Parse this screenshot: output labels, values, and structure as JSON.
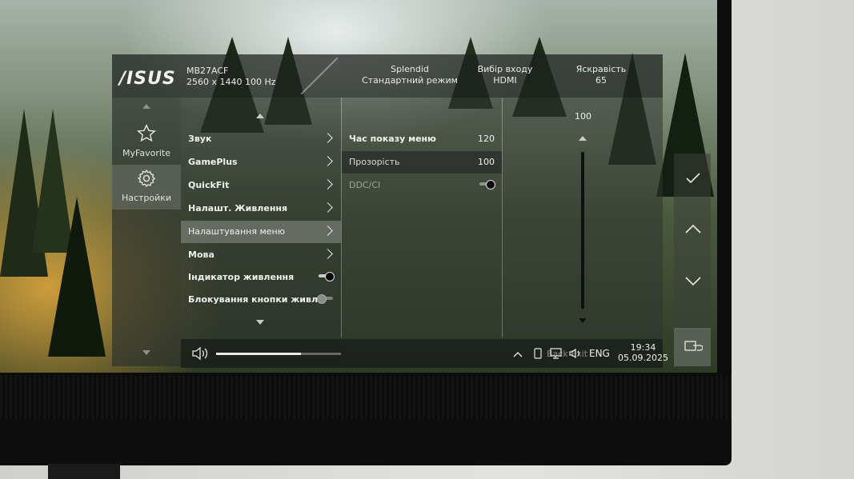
{
  "osd": {
    "brand": "/ISUS",
    "model": "MB27ACF",
    "spec": "2560 x 1440    100 Hz",
    "header_stats": [
      {
        "label": "Splendid",
        "value": "Стандартний режим"
      },
      {
        "label": "Вибір входу",
        "value": "HDMI"
      },
      {
        "label": "Яскравість",
        "value": "65"
      }
    ],
    "sidebar": [
      {
        "label": "MyFavorite",
        "icon": "star-icon",
        "selected": false
      },
      {
        "label": "Настройки",
        "icon": "gear-icon",
        "selected": true
      }
    ],
    "menu": [
      {
        "label": "Звук",
        "type": "submenu"
      },
      {
        "label": "GamePlus",
        "type": "submenu"
      },
      {
        "label": "QuickFit",
        "type": "submenu"
      },
      {
        "label": "Налашт. Живлення",
        "type": "submenu"
      },
      {
        "label": "Налаштування меню",
        "type": "submenu",
        "selected": true
      },
      {
        "label": "Мова",
        "type": "submenu"
      },
      {
        "label": "Індикатор живлення",
        "type": "toggle",
        "on": true
      },
      {
        "label": "Блокування кнопки живл.",
        "type": "toggle",
        "on": false
      }
    ],
    "submenu": [
      {
        "label": "Час показу меню",
        "value": "120"
      },
      {
        "label": "Прозорість",
        "value": "100",
        "selected": true
      },
      {
        "label": "DDC/CI",
        "toggle": true,
        "dim": true
      }
    ],
    "slider": {
      "value": "100"
    }
  },
  "taskbar": {
    "volume_fraction": 0.68,
    "overlay_text": "Back  Exit",
    "language": "ENG",
    "time": "19:34",
    "date": "05.09.2025"
  },
  "buttons": [
    "check-icon",
    "chevron-up-icon",
    "chevron-down-icon",
    "input-source-icon"
  ],
  "colors": {
    "selected_row": "#8c908a",
    "panel_bg": "#3c423c"
  }
}
